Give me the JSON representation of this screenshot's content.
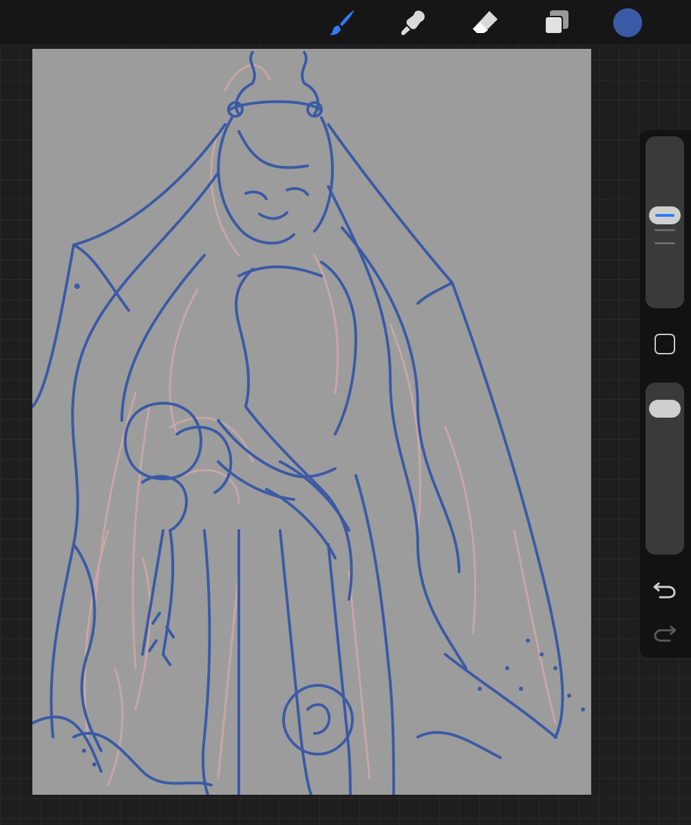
{
  "colors": {
    "accent": "#2e7bf6",
    "current_color": "#3b5aa6",
    "canvas_bg": "#9c9c9c",
    "sketch_blue": "#3b5aa6",
    "sketch_pink": "#d8a9a8"
  },
  "toolbar": {
    "tools": [
      {
        "icon": "brush-icon",
        "active": true
      },
      {
        "icon": "smudge-icon",
        "active": false
      },
      {
        "icon": "eraser-icon",
        "active": false
      },
      {
        "icon": "layers-icon",
        "active": false
      }
    ],
    "color_swatch_icon": "color-swatch"
  },
  "sidebar": {
    "brush_size_level": 0.55,
    "opacity_level": 0.92,
    "modify_icon": "modify-square-icon",
    "undo_icon": "undo-icon",
    "redo_icon": "redo-icon",
    "redo_enabled": false
  }
}
